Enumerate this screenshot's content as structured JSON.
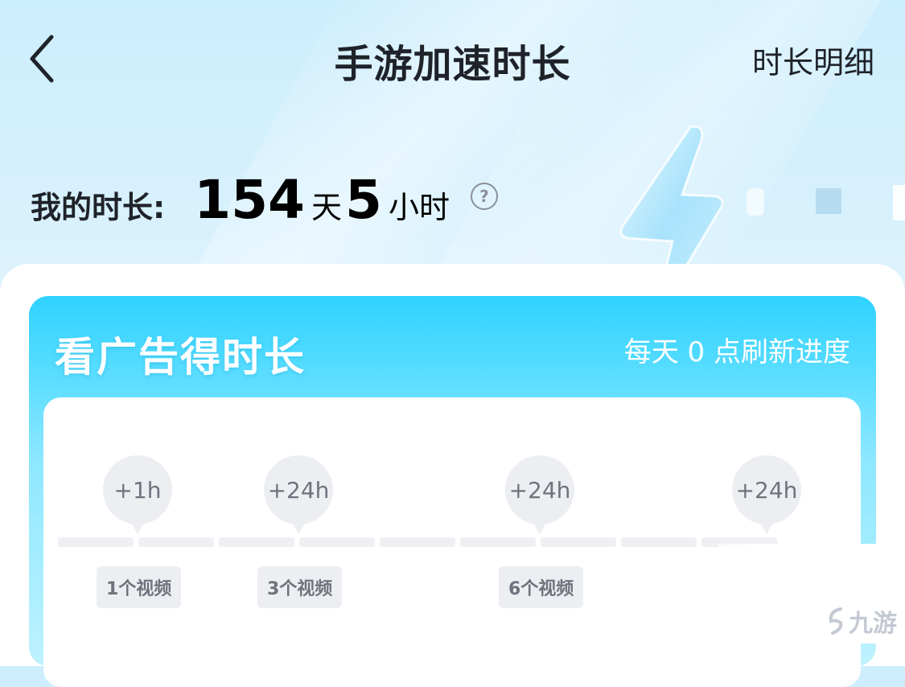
{
  "header": {
    "title": "手游加速时长",
    "detail_link": "时长明细",
    "back_icon": "chevron-left-icon"
  },
  "duration": {
    "label": "我的时长:",
    "days": "154",
    "days_unit": "天",
    "hours": "5",
    "hours_unit": "小时",
    "help_icon": "question-circle-icon",
    "help_glyph": "?"
  },
  "ad_card": {
    "title": "看广告得时长",
    "refresh_note": "每天 0 点刷新进度",
    "rewards": [
      {
        "reward": "+1h"
      },
      {
        "reward": "+24h"
      },
      {
        "reward": "+24h"
      },
      {
        "reward": "+24h"
      }
    ],
    "milestones": [
      {
        "label": "1个视频"
      },
      {
        "label": "3个视频"
      },
      {
        "label": "6个视频"
      }
    ],
    "progress_segments_total": 9,
    "progress_segments_filled": 0
  },
  "watermark": {
    "text": "九游",
    "icon": "nine-game-logo-icon"
  },
  "colors": {
    "accent": "#2fd2ff",
    "reward_bg": "#eceef2",
    "reward_text": "#6e737c"
  }
}
